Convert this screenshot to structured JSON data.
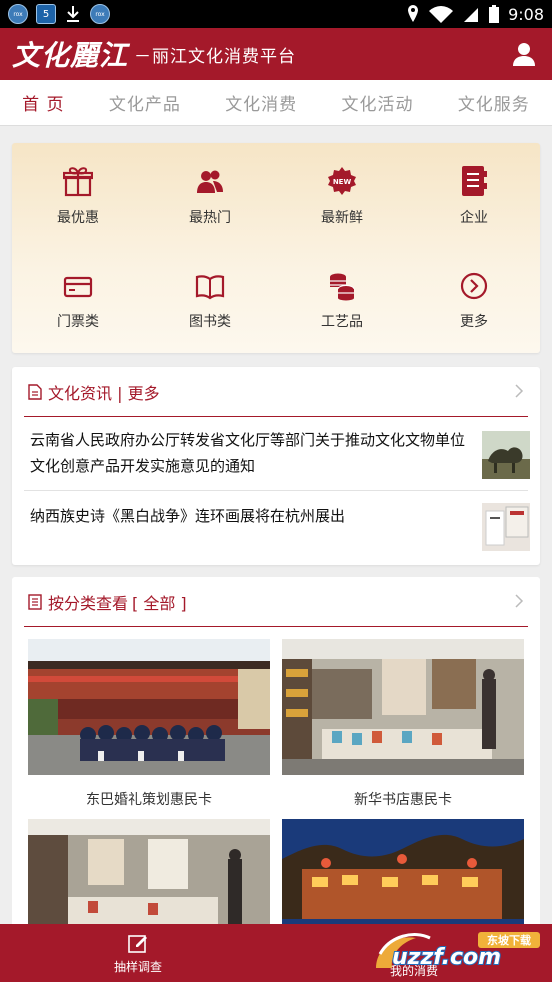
{
  "status_bar": {
    "apps": [
      "app-icon",
      "app-icon",
      "download-icon",
      "app-icon"
    ],
    "app_badges": [
      "rox",
      "5",
      "rox"
    ],
    "time": "9:08"
  },
  "header": {
    "logo": "文化麗江",
    "slogan": "－丽江文化消费平台"
  },
  "tabs": [
    {
      "label": "首 页",
      "active": true
    },
    {
      "label": "文化产品"
    },
    {
      "label": "文化消费"
    },
    {
      "label": "文化活动"
    },
    {
      "label": "文化服务"
    }
  ],
  "grid": [
    {
      "label": "最优惠",
      "icon": "gift-icon"
    },
    {
      "label": "最热门",
      "icon": "people-icon"
    },
    {
      "label": "最新鲜",
      "icon": "new-badge-icon"
    },
    {
      "label": "企业",
      "icon": "book-list-icon"
    },
    {
      "label": "门票类",
      "icon": "ticket-card-icon"
    },
    {
      "label": "图书类",
      "icon": "open-book-icon"
    },
    {
      "label": "工艺品",
      "icon": "coins-stack-icon"
    },
    {
      "label": "更多",
      "icon": "chevron-circle-icon"
    }
  ],
  "news": {
    "title": "文化资讯 | 更多",
    "items": [
      {
        "text": "云南省人民政府办公厅转发省文化厅等部门关于推动文化文物单位文化创意产品开发实施意见的通知"
      },
      {
        "text": "纳西族史诗《黑白战争》连环画展将在杭州展出"
      }
    ]
  },
  "categories": {
    "title": "按分类查看",
    "filter": "[ 全部 ]",
    "items": [
      {
        "caption": "东巴婚礼策划惠民卡"
      },
      {
        "caption": "新华书店惠民卡"
      },
      {
        "caption": ""
      },
      {
        "caption": ""
      }
    ]
  },
  "bottom_bar": {
    "left": "抽样调查",
    "right": "我的消费"
  },
  "watermark": {
    "brand": "uzzf.com",
    "tag": "东坡下载"
  },
  "colors": {
    "brand": "#a4192a",
    "grid_bg": "#f6e5c6"
  }
}
